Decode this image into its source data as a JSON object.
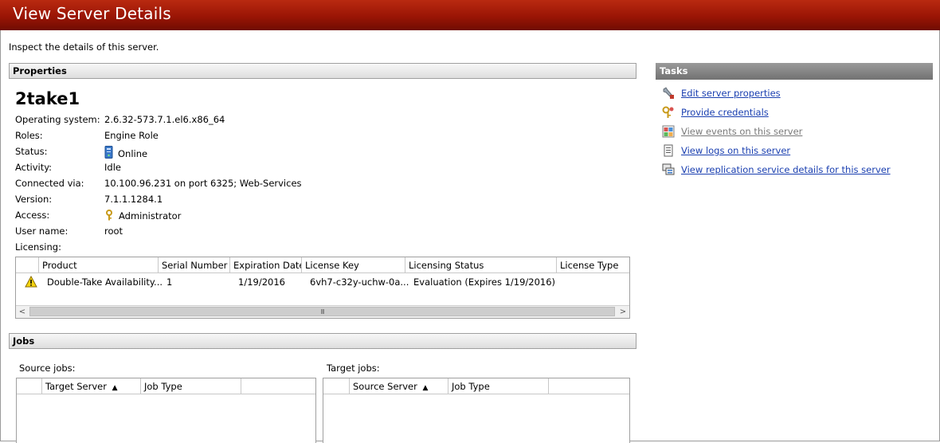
{
  "window": {
    "title": "View Server Details"
  },
  "subtitle": "Inspect the details of this server.",
  "properties": {
    "header": "Properties",
    "server_name": "2take1",
    "rows": [
      {
        "label": "Operating system:",
        "value": "2.6.32-573.7.1.el6.x86_64"
      },
      {
        "label": "Roles:",
        "value": "Engine Role"
      },
      {
        "label": "Status:",
        "value": "Online",
        "icon": "server-online-icon"
      },
      {
        "label": "Activity:",
        "value": "Idle"
      },
      {
        "label": "Connected via:",
        "value": "10.100.96.231 on port 6325; Web-Services"
      },
      {
        "label": "Version:",
        "value": "7.1.1.1284.1"
      },
      {
        "label": "Access:",
        "value": "Administrator",
        "icon": "key-icon"
      },
      {
        "label": "User name:",
        "value": "root"
      },
      {
        "label": "Licensing:",
        "value": ""
      }
    ],
    "licensing": {
      "columns": [
        "Product",
        "Serial Number",
        "Expiration Date",
        "License Key",
        "Licensing Status",
        "License Type"
      ],
      "rows": [
        {
          "icon": "warning-icon",
          "product": "Double-Take Availability...",
          "serial": "1",
          "expiration": "1/19/2016",
          "key": "6vh7-c32y-uchw-0a...",
          "status": "Evaluation (Expires 1/19/2016)",
          "type": ""
        }
      ],
      "scroll_left": "<",
      "scroll_right": ">",
      "scroll_grip": "III"
    }
  },
  "tasks": {
    "header": "Tasks",
    "items": [
      {
        "label": "Edit server properties",
        "icon": "wrench-icon",
        "enabled": true
      },
      {
        "label": "Provide credentials",
        "icon": "credentials-key-icon",
        "enabled": true
      },
      {
        "label": "View events on this server",
        "icon": "events-icon",
        "enabled": false
      },
      {
        "label": "View logs on this server",
        "icon": "log-icon",
        "enabled": true
      },
      {
        "label": "View replication service details for this server",
        "icon": "replication-icon",
        "enabled": true
      }
    ]
  },
  "jobs": {
    "header": "Jobs",
    "source": {
      "label": "Source jobs:",
      "columns": [
        "Target Server",
        "Job Type"
      ],
      "sort_indicator": "▲"
    },
    "target": {
      "label": "Target jobs:",
      "columns": [
        "Source Server",
        "Job Type"
      ],
      "sort_indicator": "▲"
    }
  }
}
